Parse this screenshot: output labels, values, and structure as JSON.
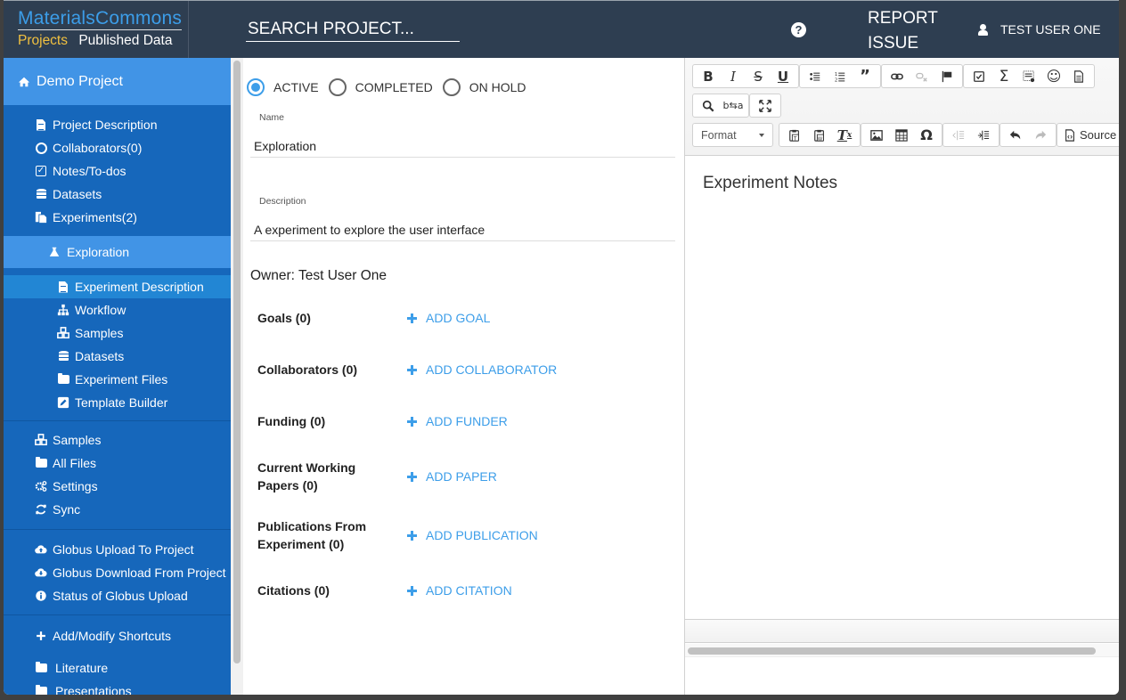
{
  "header": {
    "brand_title": "MaterialsCommons",
    "nav_projects": "Projects",
    "nav_published": "Published Data",
    "search_placeholder": "SEARCH PROJECT...",
    "help_icon": "question-circle",
    "report_issue": "REPORT ISSUE",
    "user_name": "TEST USER ONE"
  },
  "sidebar": {
    "project_name": "Demo Project",
    "project_items": [
      {
        "label": "Project Description",
        "icon": "file-text"
      },
      {
        "label": "Collaborators(0)",
        "icon": "user-circle"
      },
      {
        "label": "Notes/To-dos",
        "icon": "check-square"
      },
      {
        "label": "Datasets",
        "icon": "database"
      },
      {
        "label": "Experiments(2)",
        "icon": "copy"
      }
    ],
    "experiment": {
      "label": "Exploration",
      "icon": "flask"
    },
    "experiment_items": [
      {
        "label": "Experiment Description",
        "icon": "file-text",
        "active": true
      },
      {
        "label": "Workflow",
        "icon": "sitemap"
      },
      {
        "label": "Samples",
        "icon": "cubes"
      },
      {
        "label": "Datasets",
        "icon": "database"
      },
      {
        "label": "Experiment Files",
        "icon": "folder"
      },
      {
        "label": "Template Builder",
        "icon": "edit"
      }
    ],
    "general_items": [
      {
        "label": "Samples",
        "icon": "cubes"
      },
      {
        "label": "All Files",
        "icon": "folder"
      },
      {
        "label": "Settings",
        "icon": "cogs"
      },
      {
        "label": "Sync",
        "icon": "refresh"
      }
    ],
    "globus_items": [
      {
        "label": "Globus Upload To Project",
        "icon": "cloud-upload"
      },
      {
        "label": "Globus Download From Project",
        "icon": "cloud-download"
      },
      {
        "label": "Status of Globus Upload",
        "icon": "info-circle"
      }
    ],
    "shortcuts_label": "Add/Modify Shortcuts",
    "shortcuts": [
      {
        "label": "Literature",
        "icon": "folder"
      },
      {
        "label": "Presentations",
        "icon": "folder"
      }
    ]
  },
  "form": {
    "status_options": [
      {
        "label": "ACTIVE",
        "selected": true
      },
      {
        "label": "COMPLETED",
        "selected": false
      },
      {
        "label": "ON HOLD",
        "selected": false
      }
    ],
    "name_label": "Name",
    "name_value": "Exploration",
    "description_label": "Description",
    "description_value": "A experiment to explore the user interface",
    "owner": "Owner: Test User One",
    "sections": [
      {
        "label": "Goals (0)",
        "action": "ADD GOAL"
      },
      {
        "label": "Collaborators (0)",
        "action": "ADD COLLABORATOR"
      },
      {
        "label": "Funding (0)",
        "action": "ADD FUNDER"
      },
      {
        "label": "Current Working Papers (0)",
        "action": "ADD PAPER"
      },
      {
        "label": "Publications From Experiment (0)",
        "action": "ADD PUBLICATION"
      },
      {
        "label": "Citations (0)",
        "action": "ADD CITATION"
      }
    ]
  },
  "editor": {
    "format_label": "Format",
    "source_label": "Source",
    "content_heading": "Experiment Notes"
  },
  "colors": {
    "topbar": "#2e3e51",
    "sidebar": "#1667bb",
    "sidebar_highlight": "#4194e6",
    "accent": "#3d9ee9",
    "brand_yellow": "#f0c040"
  }
}
